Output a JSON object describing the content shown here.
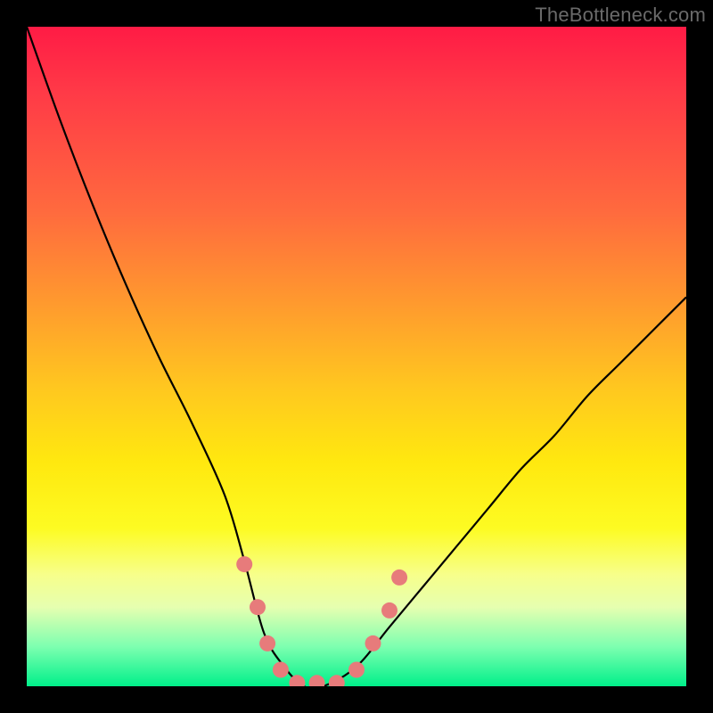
{
  "watermark": "TheBottleneck.com",
  "chart_data": {
    "type": "line",
    "title": "",
    "xlabel": "",
    "ylabel": "",
    "xlim": [
      0,
      100
    ],
    "ylim": [
      0,
      100
    ],
    "series": [
      {
        "name": "bottleneck-curve",
        "x": [
          0,
          5,
          10,
          15,
          20,
          25,
          30,
          33,
          36,
          39,
          42,
          45,
          50,
          55,
          60,
          65,
          70,
          75,
          80,
          85,
          90,
          95,
          100
        ],
        "values": [
          100,
          86,
          73,
          61,
          50,
          40,
          29,
          19,
          8,
          3,
          0,
          0,
          3,
          9,
          15,
          21,
          27,
          33,
          38,
          44,
          49,
          54,
          59
        ]
      }
    ],
    "markers": {
      "color": "#e77b7b",
      "radius_px": 9,
      "points": [
        {
          "x": 33.0,
          "y": 18.5
        },
        {
          "x": 35.0,
          "y": 12.0
        },
        {
          "x": 36.5,
          "y": 6.5
        },
        {
          "x": 38.5,
          "y": 2.5
        },
        {
          "x": 41.0,
          "y": 0.5
        },
        {
          "x": 44.0,
          "y": 0.5
        },
        {
          "x": 47.0,
          "y": 0.5
        },
        {
          "x": 50.0,
          "y": 2.5
        },
        {
          "x": 52.5,
          "y": 6.5
        },
        {
          "x": 55.0,
          "y": 11.5
        },
        {
          "x": 56.5,
          "y": 16.5
        }
      ]
    },
    "background_gradient": {
      "orientation": "vertical",
      "stops": [
        {
          "pos": 0.0,
          "color": "#ff1b45"
        },
        {
          "pos": 0.55,
          "color": "#ffc81f"
        },
        {
          "pos": 0.76,
          "color": "#fdfb22"
        },
        {
          "pos": 1.0,
          "color": "#00f08a"
        }
      ]
    }
  }
}
